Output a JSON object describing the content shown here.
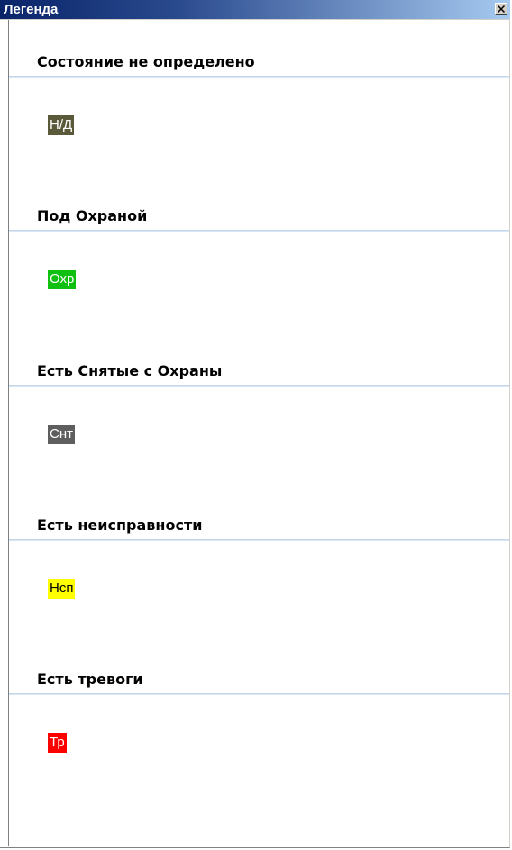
{
  "window": {
    "title": "Легенда",
    "close_icon": "close-icon"
  },
  "sections": [
    {
      "title": "Состояние не определено",
      "badge": {
        "label": "Н/Д",
        "background": "#5a5a3a",
        "color": "#ffffff"
      }
    },
    {
      "title": "Под Охраной",
      "badge": {
        "label": "Охр",
        "background": "#10c010",
        "color": "#ffffff"
      }
    },
    {
      "title": "Есть Снятые с Охраны",
      "badge": {
        "label": "Снт",
        "background": "#5e5e5e",
        "color": "#ffffff"
      }
    },
    {
      "title": "Есть неисправности",
      "badge": {
        "label": "Нсп",
        "background": "#ffff00",
        "color": "#000000"
      }
    },
    {
      "title": "Есть тревоги",
      "badge": {
        "label": "Тр",
        "background": "#ff0000",
        "color": "#ffffff"
      }
    }
  ]
}
